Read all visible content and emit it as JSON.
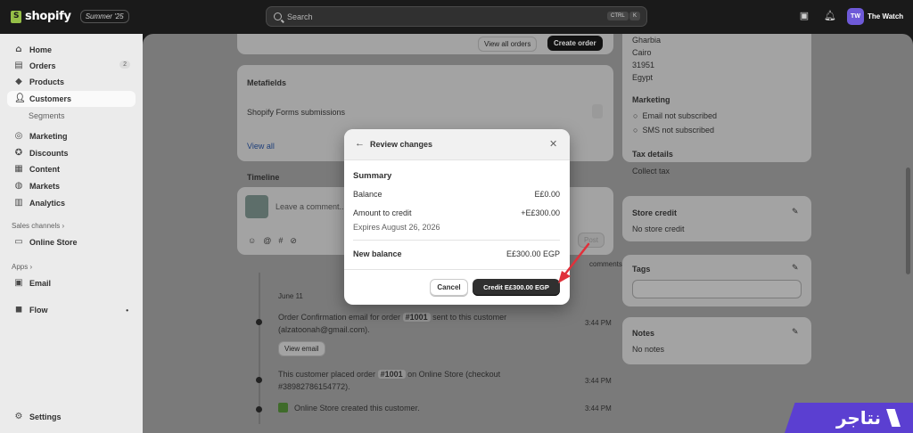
{
  "topbar": {
    "brand": "shopify",
    "edition": "Summer '25",
    "search_placeholder": "Search",
    "shortcut_ctrl": "CTRL",
    "shortcut_key": "K",
    "store_initials": "TW",
    "store_name": "The Watch"
  },
  "sidebar": {
    "home": "Home",
    "orders": "Orders",
    "orders_count": "2",
    "products": "Products",
    "customers": "Customers",
    "segments": "Segments",
    "marketing": "Marketing",
    "discounts": "Discounts",
    "content": "Content",
    "markets": "Markets",
    "analytics": "Analytics",
    "sales_channels": "Sales channels",
    "online_store": "Online Store",
    "apps": "Apps",
    "email": "Email",
    "flow": "Flow",
    "settings": "Settings"
  },
  "main": {
    "view_all_orders": "View all orders",
    "create_order": "Create order",
    "metafields_title": "Metafields",
    "metafield_row": "Shopify Forms submissions",
    "view_all": "View all",
    "timeline_title": "Timeline",
    "comment_placeholder": "Leave a comment...",
    "post": "Post",
    "comments_note": "comments",
    "date": "June 11",
    "event1_a": "Order Confirmation email for order",
    "event1_order": "#1001",
    "event1_b": "sent to this customer",
    "event1_c": "(alzatoonah@gmail.com).",
    "view_email": "View email",
    "event1_time": "3:44 PM",
    "event2_a": "This customer placed order",
    "event2_order": "#1001",
    "event2_b": "on Online Store (checkout",
    "event2_c": "#38982786154772).",
    "event2_time": "3:44 PM",
    "event3": "Online Store created this customer.",
    "event3_time": "3:44 PM"
  },
  "right": {
    "addr1": "Gharbia",
    "addr2": "Cairo",
    "addr3": "31951",
    "addr4": "Egypt",
    "marketing_title": "Marketing",
    "email_status": "Email not subscribed",
    "sms_status": "SMS not subscribed",
    "tax_title": "Tax details",
    "tax_value": "Collect tax",
    "store_credit_title": "Store credit",
    "store_credit_value": "No store credit",
    "tags_title": "Tags",
    "notes_title": "Notes",
    "notes_value": "No notes"
  },
  "modal": {
    "title": "Review changes",
    "summary": "Summary",
    "balance_label": "Balance",
    "balance_value": "E£0.00",
    "credit_label": "Amount to credit",
    "credit_value": "+E£300.00",
    "expires": "Expires August 26, 2026",
    "new_balance_label": "New balance",
    "new_balance_value": "E£300.00 EGP",
    "cancel": "Cancel",
    "confirm": "Credit E£300.00 EGP"
  },
  "watermark": {
    "text": "نتاجر"
  },
  "colors": {
    "accent_red": "#e0303a",
    "watermark_purple": "#5b3fd1",
    "avatar_purple": "#6e5ad8"
  }
}
